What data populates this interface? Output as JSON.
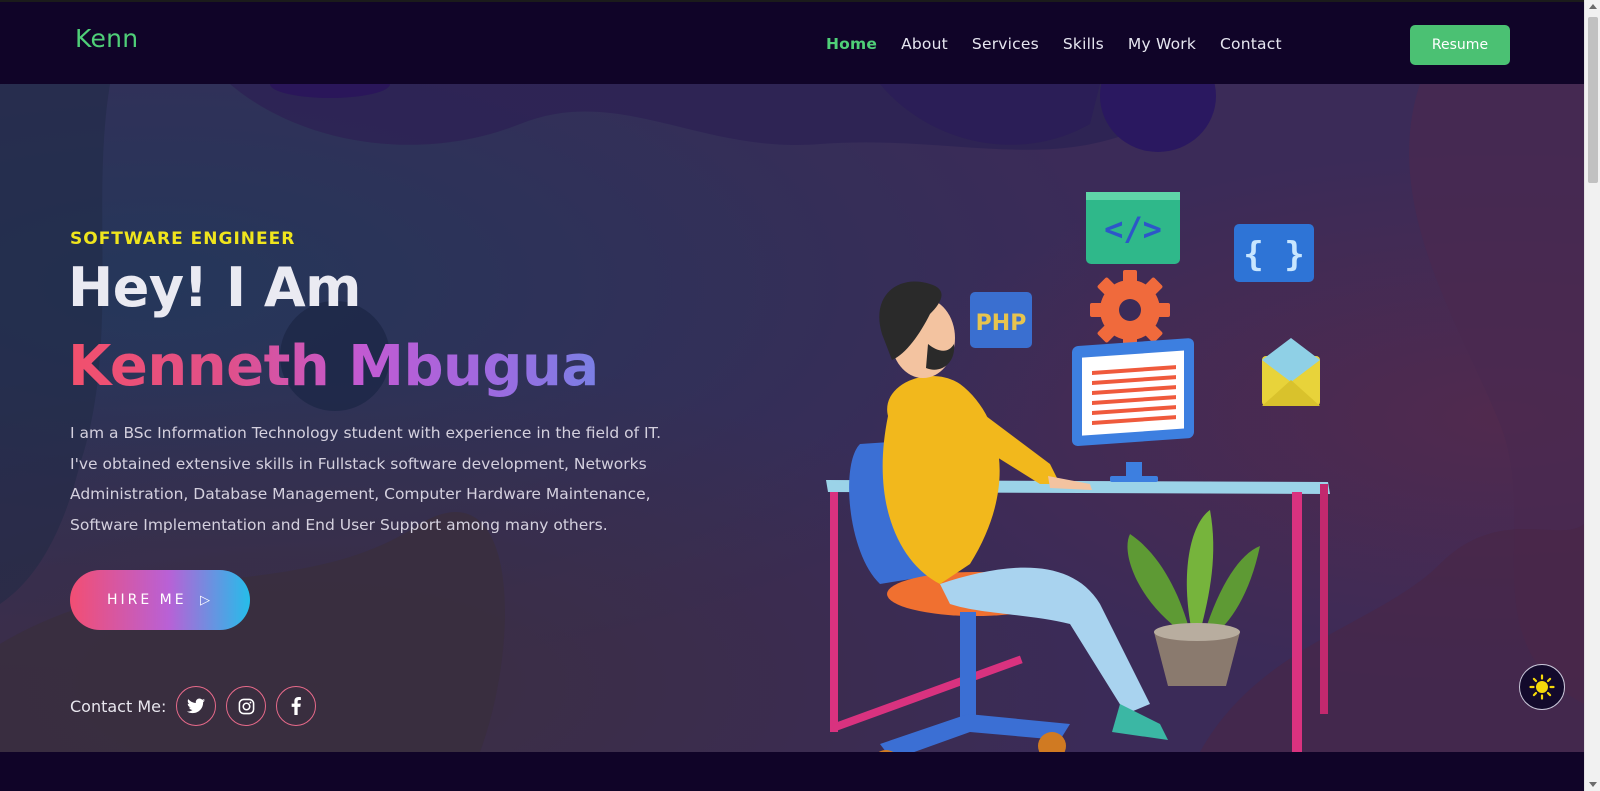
{
  "nav": {
    "brand": "Kenn",
    "links": [
      "Home",
      "About",
      "Services",
      "Skills",
      "My Work",
      "Contact"
    ],
    "active": "Home",
    "resume_label": "Resume"
  },
  "hero": {
    "tagline": "SOFTWARE ENGINEER",
    "greeting": "Hey! I Am",
    "name": "Kenneth Mbugua",
    "bio": "I am a BSc Information Technology student with experience in the field of IT. I've obtained extensive skills in Fullstack software development, Networks Administration, Database Management, Computer Hardware Maintenance, Software Implementation and End User Support among many others.",
    "hire_label": "HIRE ME",
    "hire_icon": "send-icon",
    "contact_label": "Contact Me:",
    "socials": [
      "twitter-icon",
      "instagram-icon",
      "facebook-icon"
    ],
    "illustration_labels": {
      "code_tag": "</>",
      "braces": "{ }",
      "php": "PHP"
    }
  },
  "theme_toggle_icon": "sun-icon",
  "colors": {
    "accent": "#4fcf78",
    "tagline": "#f0e51d",
    "nav_bg": "#100428",
    "hero_bg": "#3a2a57"
  }
}
